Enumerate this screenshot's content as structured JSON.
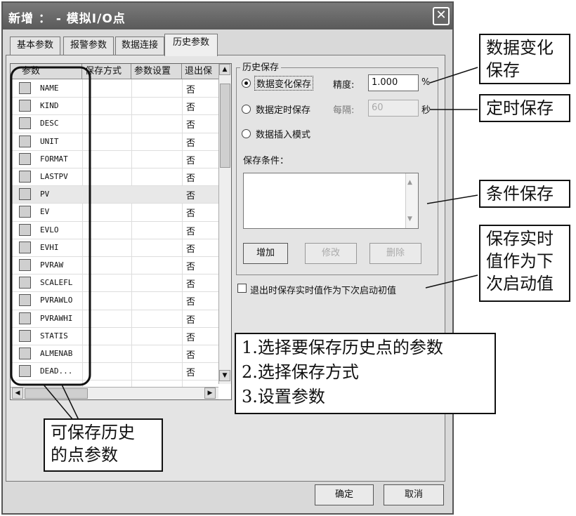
{
  "window": {
    "title": "新增 ： - 模拟I/O点",
    "close_glyph": "✕"
  },
  "tabs": [
    {
      "label": "基本参数"
    },
    {
      "label": "报警参数"
    },
    {
      "label": "数据连接"
    },
    {
      "label": "历史参数"
    }
  ],
  "list": {
    "columns": [
      "参数",
      "保存方式",
      "参数设置",
      "退出保"
    ],
    "rows": [
      {
        "name": "NAME",
        "value": "否"
      },
      {
        "name": "KIND",
        "value": "否"
      },
      {
        "name": "DESC",
        "value": "否"
      },
      {
        "name": "UNIT",
        "value": "否"
      },
      {
        "name": "FORMAT",
        "value": "否"
      },
      {
        "name": "LASTPV",
        "value": "否"
      },
      {
        "name": "PV",
        "value": "否"
      },
      {
        "name": "EV",
        "value": "否"
      },
      {
        "name": "EVLO",
        "value": "否"
      },
      {
        "name": "EVHI",
        "value": "否"
      },
      {
        "name": "PVRAW",
        "value": "否"
      },
      {
        "name": "SCALEFL",
        "value": "否"
      },
      {
        "name": "PVRAWLO",
        "value": "否"
      },
      {
        "name": "PVRAWHI",
        "value": "否"
      },
      {
        "name": "STATIS",
        "value": "否"
      },
      {
        "name": "ALMENAB",
        "value": "否"
      },
      {
        "name": "DEAD...",
        "value": "否"
      }
    ]
  },
  "history": {
    "group_label": "历史保存",
    "options": [
      {
        "label": "数据变化保存"
      },
      {
        "label": "数据定时保存"
      },
      {
        "label": "数据插入模式"
      }
    ],
    "precision_label": "精度:",
    "precision_value": "1.000",
    "precision_unit": "%",
    "interval_label": "每隔:",
    "interval_value": "60",
    "interval_unit": "秒",
    "condition_label": "保存条件：",
    "add_button": "增加",
    "edit_button": "修改",
    "delete_button": "删除"
  },
  "exit_checkbox_label": "退出时保存实时值作为下次启动初值",
  "footer": {
    "ok_button": "确定",
    "cancel_button": "取消"
  },
  "annotations": {
    "change_save": [
      "数据变化",
      "保存"
    ],
    "timed_save": "定时保存",
    "condition_save": "条件保存",
    "exit_save": [
      "保存实时",
      "值作为下",
      "次启动值"
    ],
    "steps": [
      "1.选择要保存历史点的参数",
      "2.选择保存方式",
      "3.设置参数"
    ],
    "points": [
      "可保存历史",
      "的点参数"
    ]
  }
}
